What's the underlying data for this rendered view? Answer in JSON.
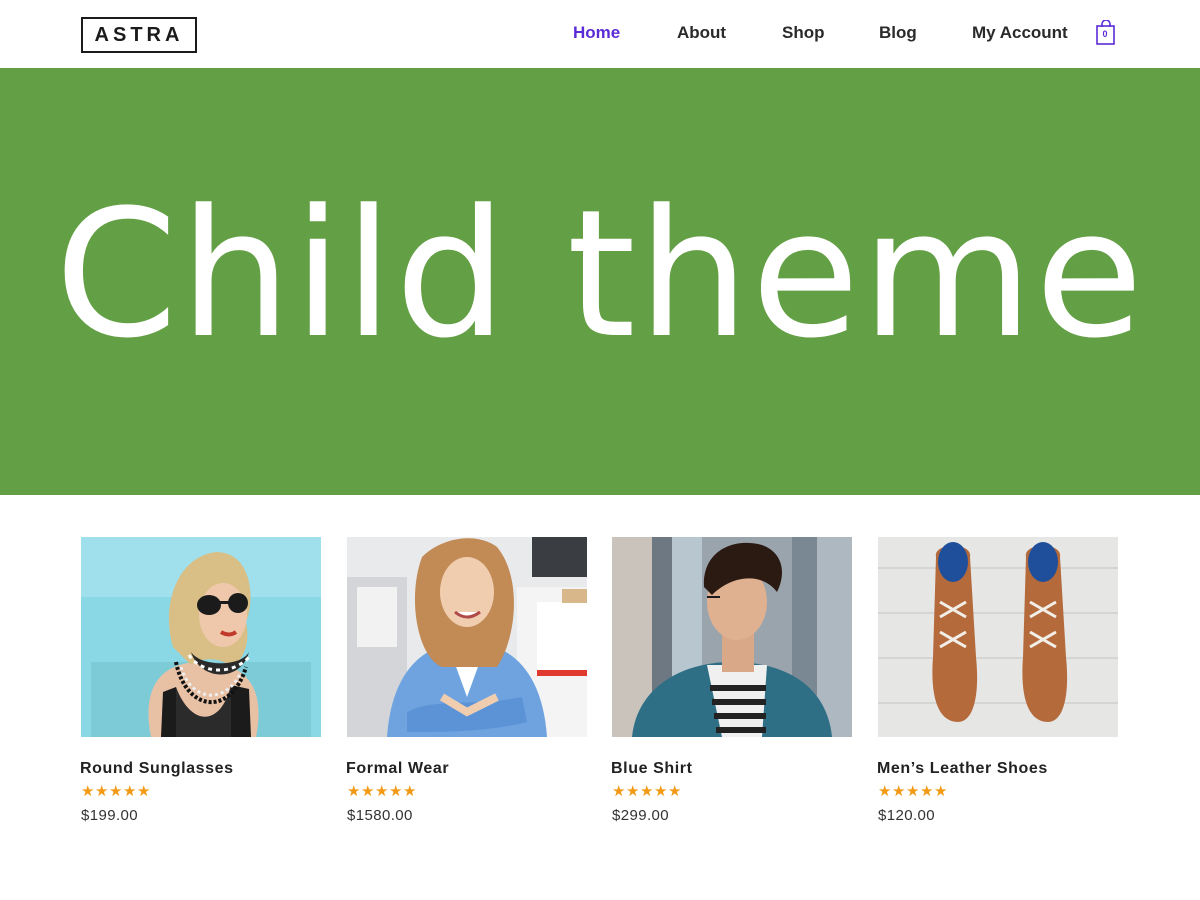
{
  "header": {
    "logo_text": "ASTRA",
    "nav": [
      {
        "label": "Home",
        "active": true
      },
      {
        "label": "About",
        "active": false
      },
      {
        "label": "Shop",
        "active": false
      },
      {
        "label": "Blog",
        "active": false
      },
      {
        "label": "My Account",
        "active": false
      }
    ],
    "cart_count": "0",
    "cart_icon": "shopping-bag-icon"
  },
  "hero": {
    "title": "Child theme",
    "background_color": "#639f44"
  },
  "colors": {
    "accent": "#5b2bd6",
    "star": "#f29a16"
  },
  "products": [
    {
      "name": "Round Sunglasses",
      "rating": 5,
      "price": "$199.00"
    },
    {
      "name": "Formal Wear",
      "rating": 5,
      "price": "$1580.00"
    },
    {
      "name": "Blue Shirt",
      "rating": 5,
      "price": "$299.00"
    },
    {
      "name": "Men’s Leather Shoes",
      "rating": 5,
      "price": "$120.00"
    }
  ]
}
